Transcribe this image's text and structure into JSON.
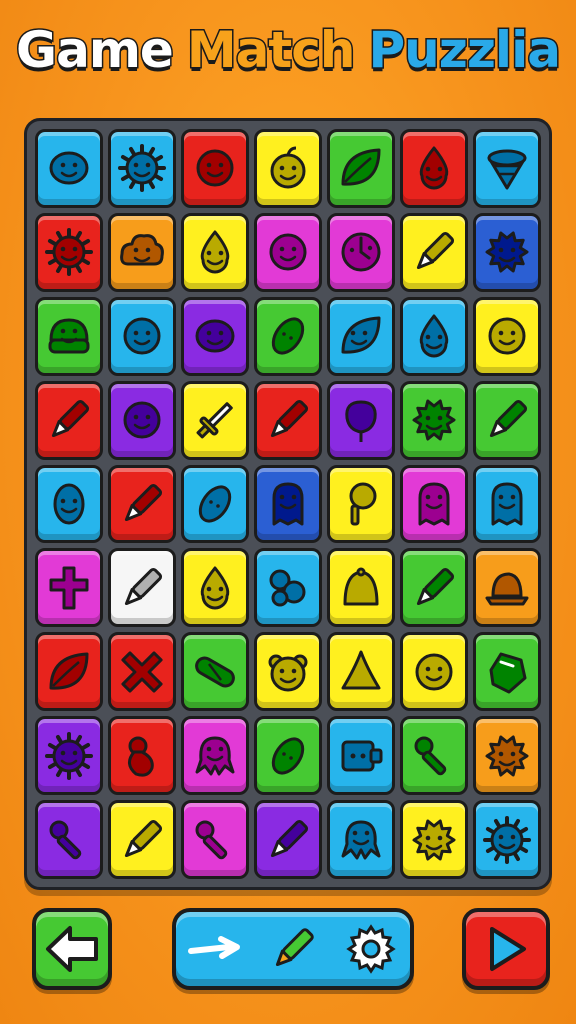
{
  "title": {
    "word1": "Game",
    "word2": "Match",
    "word3": "Puzzlia",
    "word1_color": "#ffffff",
    "word2_color": "#f7a21b",
    "word3_color": "#2aa9e8"
  },
  "palette": {
    "blue": "#27b5ec",
    "red": "#e8231d",
    "magenta": "#e23ad6",
    "yellow": "#fff01f",
    "green": "#46c933",
    "orange": "#f79d1b",
    "purple": "#8a2be2",
    "white": "#f6f6f6",
    "navy": "#2b5fd3"
  },
  "board": {
    "rows": 9,
    "cols": 7,
    "tiles": [
      [
        {
          "color": "blue",
          "icon": "blob-face"
        },
        {
          "color": "blue",
          "icon": "sun"
        },
        {
          "color": "red",
          "icon": "smiley"
        },
        {
          "color": "yellow",
          "icon": "fruit"
        },
        {
          "color": "green",
          "icon": "leaf"
        },
        {
          "color": "red",
          "icon": "drop-face"
        },
        {
          "color": "blue",
          "icon": "spinning-top"
        }
      ],
      [
        {
          "color": "red",
          "icon": "sun"
        },
        {
          "color": "orange",
          "icon": "cloud-face"
        },
        {
          "color": "yellow",
          "icon": "drop-face"
        },
        {
          "color": "magenta",
          "icon": "smiley"
        },
        {
          "color": "magenta",
          "icon": "clock-face"
        },
        {
          "color": "yellow",
          "icon": "pen"
        },
        {
          "color": "navy",
          "icon": "spiky-blob"
        }
      ],
      [
        {
          "color": "green",
          "icon": "burger-face"
        },
        {
          "color": "blue",
          "icon": "smiley"
        },
        {
          "color": "purple",
          "icon": "blob-face"
        },
        {
          "color": "green",
          "icon": "lemon"
        },
        {
          "color": "blue",
          "icon": "leaf-face"
        },
        {
          "color": "blue",
          "icon": "drop-face"
        },
        {
          "color": "yellow",
          "icon": "smiley"
        }
      ],
      [
        {
          "color": "red",
          "icon": "pen"
        },
        {
          "color": "purple",
          "icon": "smiley"
        },
        {
          "color": "yellow",
          "icon": "sword"
        },
        {
          "color": "red",
          "icon": "pen"
        },
        {
          "color": "purple",
          "icon": "balloon"
        },
        {
          "color": "green",
          "icon": "spiky-face"
        },
        {
          "color": "green",
          "icon": "pen"
        }
      ],
      [
        {
          "color": "blue",
          "icon": "egg-face"
        },
        {
          "color": "red",
          "icon": "pen"
        },
        {
          "color": "blue",
          "icon": "lemon"
        },
        {
          "color": "navy",
          "icon": "ghost"
        },
        {
          "color": "yellow",
          "icon": "lollipop"
        },
        {
          "color": "magenta",
          "icon": "ghost"
        },
        {
          "color": "blue",
          "icon": "ghost"
        }
      ],
      [
        {
          "color": "magenta",
          "icon": "cross"
        },
        {
          "color": "white",
          "icon": "pen"
        },
        {
          "color": "yellow",
          "icon": "drop-face"
        },
        {
          "color": "blue",
          "icon": "pills"
        },
        {
          "color": "yellow",
          "icon": "bell"
        },
        {
          "color": "green",
          "icon": "pen"
        },
        {
          "color": "orange",
          "icon": "hat"
        }
      ],
      [
        {
          "color": "red",
          "icon": "leaf"
        },
        {
          "color": "red",
          "icon": "x-shape"
        },
        {
          "color": "green",
          "icon": "capsule"
        },
        {
          "color": "yellow",
          "icon": "bear"
        },
        {
          "color": "yellow",
          "icon": "cone"
        },
        {
          "color": "yellow",
          "icon": "smiley"
        },
        {
          "color": "green",
          "icon": "gem"
        }
      ],
      [
        {
          "color": "purple",
          "icon": "sun"
        },
        {
          "color": "red",
          "icon": "bowling"
        },
        {
          "color": "magenta",
          "icon": "octopus"
        },
        {
          "color": "green",
          "icon": "lemon"
        },
        {
          "color": "blue",
          "icon": "box-face"
        },
        {
          "color": "green",
          "icon": "key"
        },
        {
          "color": "orange",
          "icon": "spiky-face"
        }
      ],
      [
        {
          "color": "purple",
          "icon": "key"
        },
        {
          "color": "yellow",
          "icon": "pen"
        },
        {
          "color": "magenta",
          "icon": "key"
        },
        {
          "color": "purple",
          "icon": "pen"
        },
        {
          "color": "blue",
          "icon": "octopus"
        },
        {
          "color": "yellow",
          "icon": "spiky-blob"
        },
        {
          "color": "blue",
          "icon": "sun"
        }
      ]
    ]
  },
  "controls": {
    "back_icon": "arrow-left-icon",
    "back_color": "#46c933",
    "play_icon": "play-icon",
    "play_color": "#e8231d",
    "toolbar_color": "#27b5ec",
    "tools": [
      "swipe-arrow-icon",
      "pencil-icon",
      "gear-icon"
    ]
  }
}
